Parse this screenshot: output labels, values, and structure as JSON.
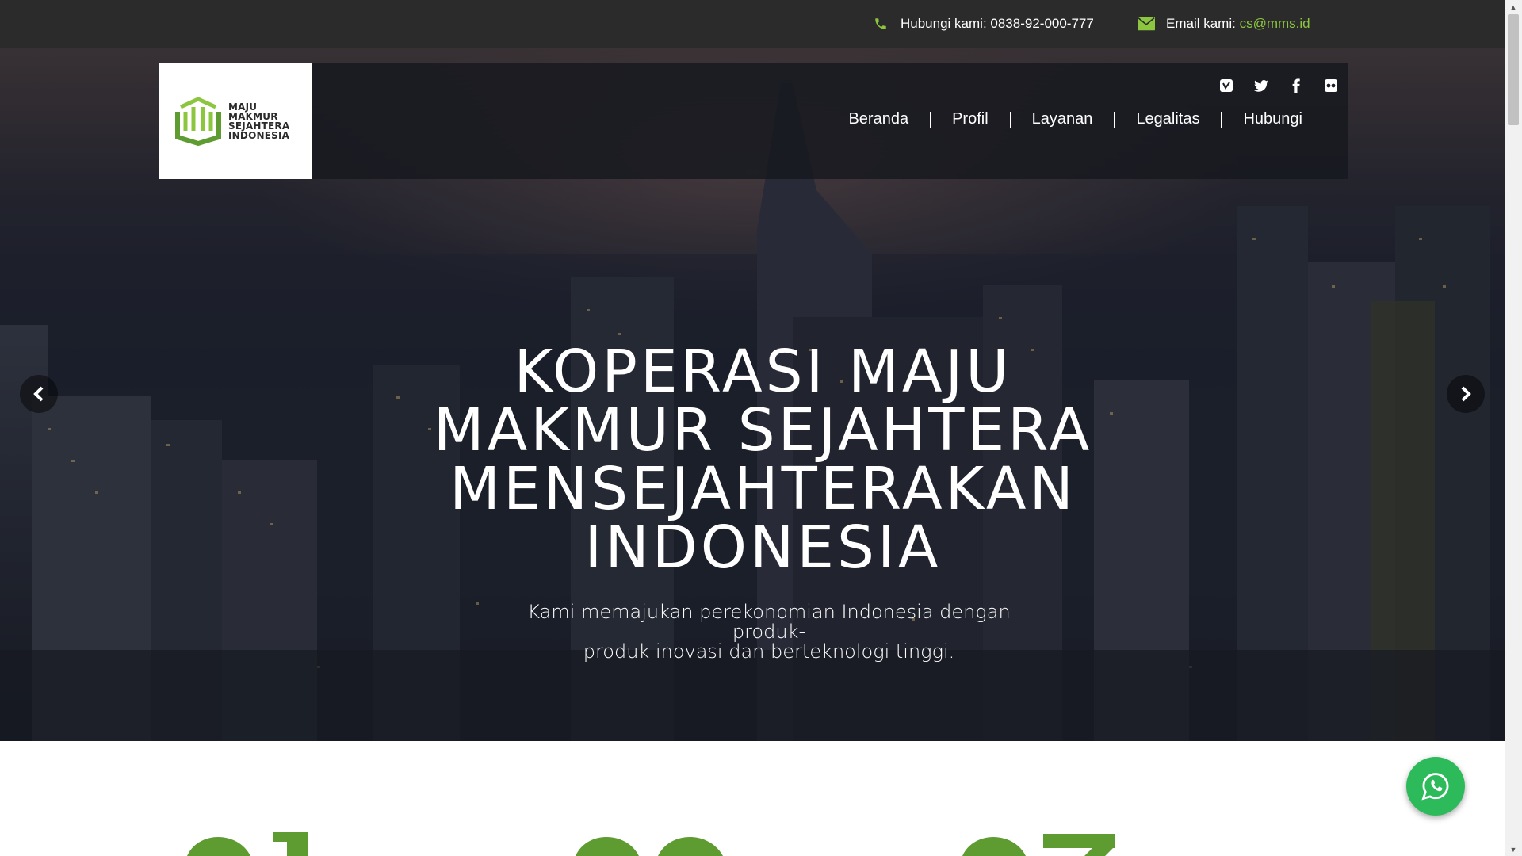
{
  "topbar": {
    "phone_label": "Hubungi kami: 0838-92-000-777",
    "email_prefix": "Email kami: ",
    "email_link": "cs@mms.id",
    "icons": [
      "phone-icon",
      "envelope-icon"
    ]
  },
  "logo": {
    "lines": [
      "MAJU",
      "MAKMUR",
      "SEJAHTERA",
      "INDONESIA"
    ],
    "mark": "mms-logo-mark"
  },
  "social": {
    "icons": [
      "vimeo-icon",
      "twitter-icon",
      "facebook-icon",
      "flickr-icon"
    ]
  },
  "nav": {
    "items": [
      "Beranda",
      "Profil",
      "Layanan",
      "Legalitas",
      "Hubungi"
    ]
  },
  "hero": {
    "headline_lines": [
      "KOPERASI MAJU",
      "MAKMUR SEJAHTERA",
      "MENSEJAHTERAKAN",
      "INDONESIA"
    ],
    "subhead_lines": [
      "Kami memajukan perekonomian Indonesia dengan produk-",
      "produk inovasi dan berteknologi tinggi."
    ],
    "arrows": [
      "chevron-left-icon",
      "chevron-right-icon"
    ]
  },
  "colors": {
    "accent_green": "#8cc63f",
    "number_green": "#5e9c32",
    "topbar_bg": "#2b2b2b",
    "whatsapp_green": "#2dba5a"
  },
  "floating": {
    "whatsapp_icon": "whatsapp-icon"
  }
}
